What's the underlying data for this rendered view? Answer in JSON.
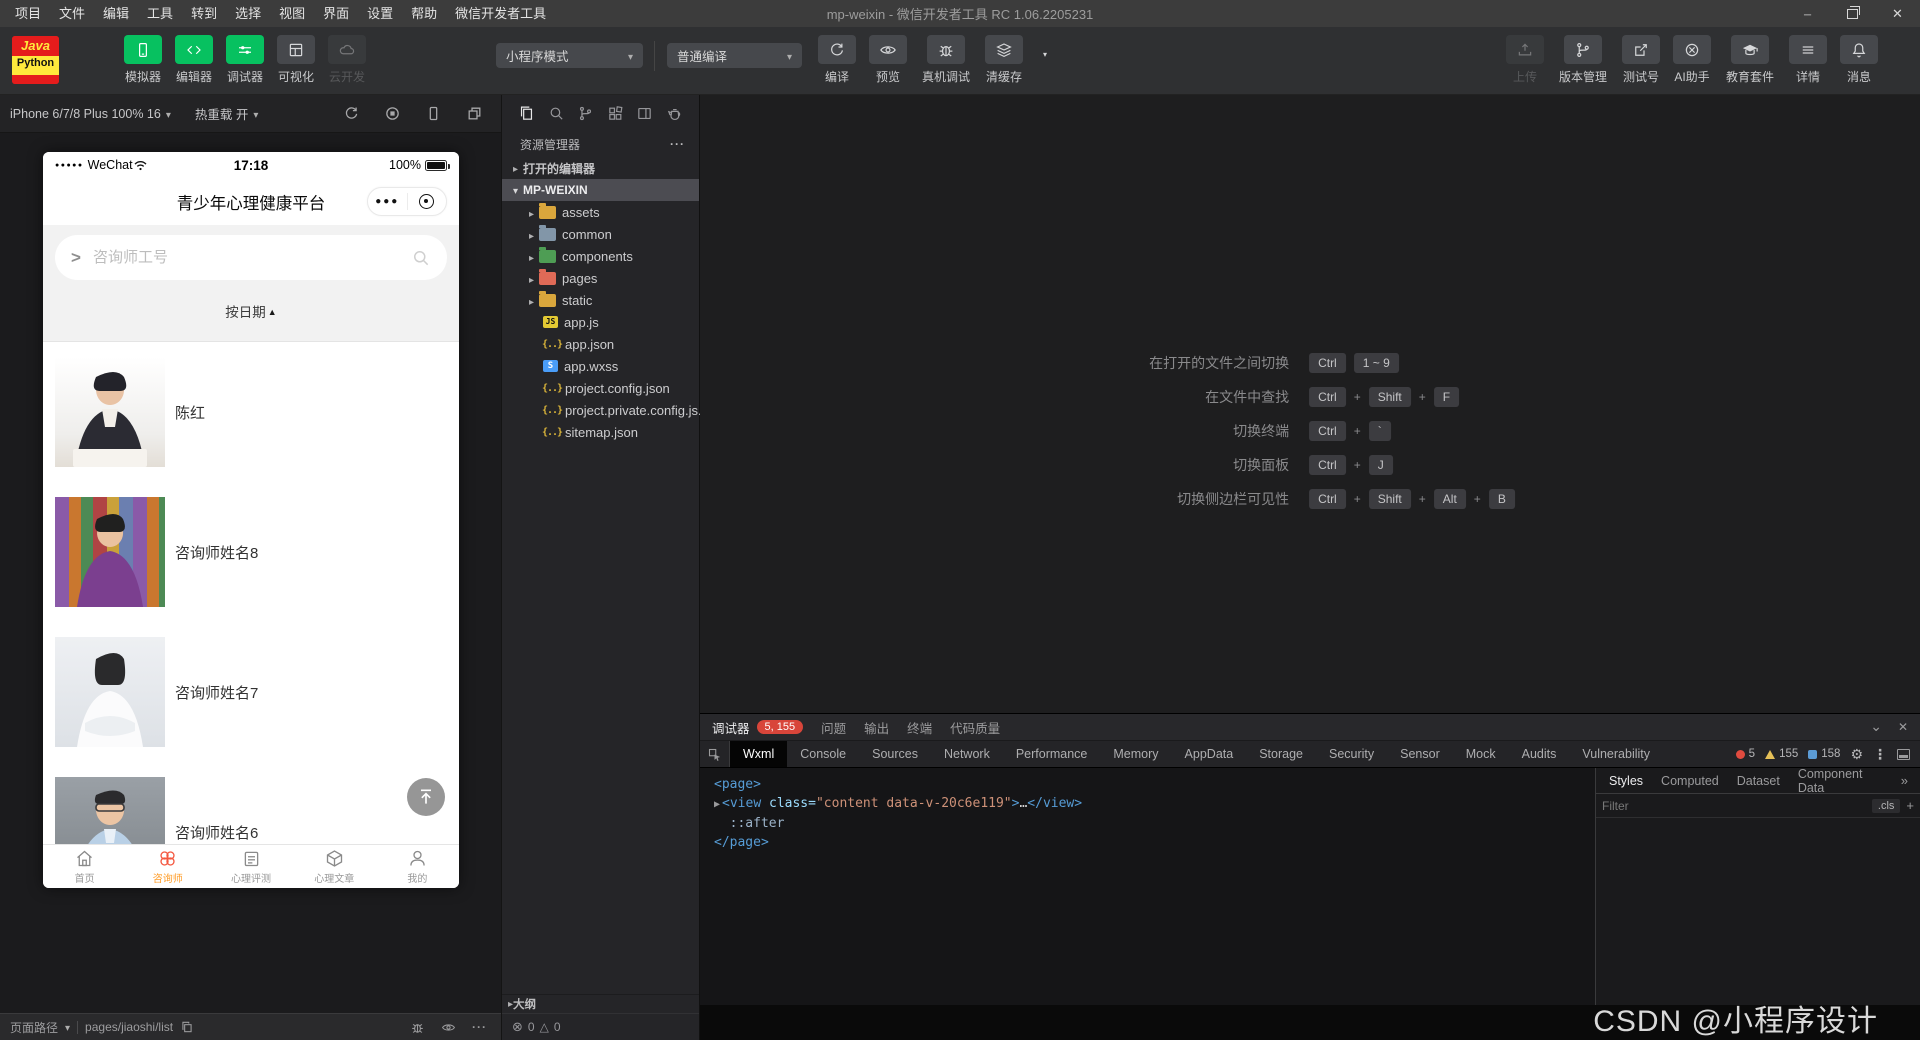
{
  "title_bar": {
    "menus": [
      "项目",
      "文件",
      "编辑",
      "工具",
      "转到",
      "选择",
      "视图",
      "界面",
      "设置",
      "帮助",
      "微信开发者工具"
    ],
    "title": "mp-weixin - 微信开发者工具 RC 1.06.2205231"
  },
  "toolbar": {
    "logo": {
      "line1": "Java",
      "line2": "Python"
    },
    "left_buttons": [
      {
        "label": "模拟器",
        "icon": "phone-icon"
      },
      {
        "label": "编辑器",
        "icon": "code-icon"
      },
      {
        "label": "调试器",
        "icon": "sliders-icon"
      },
      {
        "label": "可视化",
        "icon": "layout-icon"
      },
      {
        "label": "云开发",
        "icon": "cloud-icon"
      }
    ],
    "mode_select": "小程序模式",
    "compile_select": "普通编译",
    "compile_actions": [
      {
        "label": "编译",
        "icon": "refresh-icon"
      },
      {
        "label": "预览",
        "icon": "eye-icon"
      },
      {
        "label": "真机调试",
        "icon": "bug-icon"
      },
      {
        "label": "清缓存",
        "icon": "layers-icon"
      }
    ],
    "right_buttons": [
      {
        "label": "上传",
        "icon": "upload-icon"
      },
      {
        "label": "版本管理",
        "icon": "branch-icon"
      },
      {
        "label": "测试号",
        "icon": "external-link-icon"
      },
      {
        "label": "AI助手",
        "icon": "circle-x-icon"
      },
      {
        "label": "教育套件",
        "icon": "graduation-cap-icon"
      },
      {
        "label": "详情",
        "icon": "lines-icon"
      },
      {
        "label": "消息",
        "icon": "bell-icon"
      }
    ]
  },
  "simulator": {
    "device_selector": "iPhone 6/7/8 Plus 100% 16",
    "hot_reload": "热重载 开",
    "status_bar": {
      "label": "页面路径",
      "path": "pages/jiaoshi/list"
    },
    "phone": {
      "carrier_dots": "●●●●●",
      "carrier": "WeChat",
      "time": "17:18",
      "battery": "100%",
      "nav_title": "青少年心理健康平台",
      "search_placeholder": "咨询师工号",
      "sort_label": "按日期",
      "list": [
        {
          "name": "陈红"
        },
        {
          "name": "咨询师姓名8"
        },
        {
          "name": "咨询师姓名7"
        },
        {
          "name": "咨询师姓名6"
        }
      ],
      "tab_bar": [
        {
          "label": "首页"
        },
        {
          "label": "咨询师"
        },
        {
          "label": "心理评测"
        },
        {
          "label": "心理文章"
        },
        {
          "label": "我的"
        }
      ]
    }
  },
  "explorer": {
    "header": "资源管理器",
    "open_editors": "打开的编辑器",
    "root": "MP-WEIXIN",
    "folders": [
      {
        "name": "assets"
      },
      {
        "name": "common"
      },
      {
        "name": "components"
      },
      {
        "name": "pages"
      },
      {
        "name": "static"
      }
    ],
    "files": [
      {
        "name": "app.js",
        "badge": "JS"
      },
      {
        "name": "app.json",
        "badge": "{..}"
      },
      {
        "name": "app.wxss",
        "badge": "S"
      },
      {
        "name": "project.config.json",
        "badge": "{..}"
      },
      {
        "name": "project.private.config.js...",
        "badge": "{..}"
      },
      {
        "name": "sitemap.json",
        "badge": "{..}"
      }
    ],
    "outline": "大纲",
    "problems": {
      "errors": "0",
      "warnings": "0"
    }
  },
  "editor": {
    "plus": "+",
    "shortcuts": [
      {
        "label": "在打开的文件之间切换",
        "keys": [
          "Ctrl",
          "1 ~ 9"
        ]
      },
      {
        "label": "在文件中查找",
        "keys": [
          "Ctrl",
          "Shift",
          "F"
        ]
      },
      {
        "label": "切换终端",
        "keys": [
          "Ctrl",
          "`"
        ]
      },
      {
        "label": "切换面板",
        "keys": [
          "Ctrl",
          "J"
        ]
      },
      {
        "label": "切换侧边栏可见性",
        "keys": [
          "Ctrl",
          "Shift",
          "Alt",
          "B"
        ]
      }
    ]
  },
  "debugger": {
    "panel_tabs": {
      "debugger": "调试器",
      "problems": "问题",
      "output": "输出",
      "terminal": "终端",
      "code_quality": "代码质量"
    },
    "badge": "5, 155",
    "devtools_tabs": [
      "Wxml",
      "Console",
      "Sources",
      "Network",
      "Performance",
      "Memory",
      "AppData",
      "Storage",
      "Security",
      "Sensor",
      "Mock",
      "Audits",
      "Vulnerability"
    ],
    "active_devtools_tab": "Wxml",
    "counters": {
      "errors": "5",
      "warnings": "155",
      "messages": "158"
    },
    "dom": {
      "line1": "<page>",
      "line2_tag_open": "<view",
      "line2_attr": " class=",
      "line2_value": "\"content data-v-20c6e119\"",
      "line2_gt": ">",
      "line2_ellipsis": "…",
      "line2_tag_close": "</view>",
      "line3": "::after",
      "line4": "</page>"
    },
    "styles_panel": {
      "tabs": [
        "Styles",
        "Computed",
        "Dataset",
        "Component Data"
      ],
      "filter_placeholder": "Filter",
      "cls_label": ".cls"
    }
  },
  "watermark": "CSDN @小程序设计",
  "icons": {
    "sort-asc-icon": "▲",
    "caret-down-icon": "▾",
    "tree-chevron-icon": "▸",
    "error-circle-icon": "⊗",
    "warning-triangle-icon": "△",
    "gear-icon": "⚙",
    "more-horizontal-icon": "···",
    "more-vertical-icon": "⋮",
    "close-icon": "✕"
  }
}
